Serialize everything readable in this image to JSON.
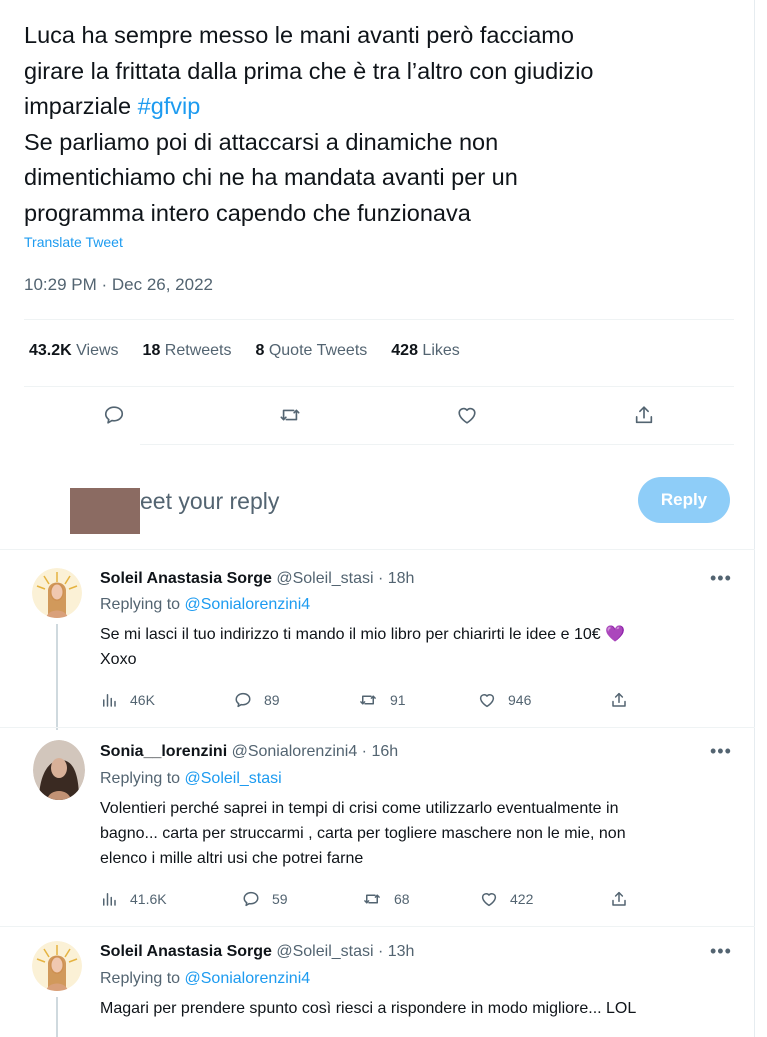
{
  "tweet": {
    "text_lines": [
      "Luca ha sempre messo le mani avanti però facciamo",
      "girare la frittata dalla prima che è tra l’altro con giudizio",
      "imparziale ",
      "Se parliamo poi di attaccarsi a dinamiche non",
      "dimentichiamo chi ne ha mandata avanti per un",
      "programma intero capendo che funzionava"
    ],
    "hashtag": "#gfvip",
    "translate_label": "Translate Tweet",
    "timestamp": "10:29 PM · Dec 26, 2022",
    "stats": {
      "views_count": "43.2K",
      "views_label": " Views",
      "retweets_count": "18",
      "retweets_label": " Retweets",
      "quotes_count": "8",
      "quotes_label": " Quote Tweets",
      "likes_count": "428",
      "likes_label": " Likes"
    },
    "action_icons": [
      "reply-icon",
      "retweet-icon",
      "like-icon",
      "share-icon"
    ]
  },
  "composer": {
    "placeholder": "eet your reply",
    "reply_button": "Reply"
  },
  "replies": [
    {
      "name": "Soleil Anastasia Sorge",
      "handle": " @Soleil_stasi · 18h",
      "replying_prefix": "Replying to ",
      "replying_to": "@Sonialorenzini4",
      "body_lines": [
        "Se mi lasci il tuo indirizzo ti mando il mio libro per chiarirti le idee e 10€ 💜",
        "Xoxo"
      ],
      "views": "46K",
      "replies": "89",
      "retweets": "91",
      "likes": "946"
    },
    {
      "name": "Sonia__lorenzini",
      "handle": " @Sonialorenzini4 · 16h",
      "replying_prefix": "Replying to ",
      "replying_to": "@Soleil_stasi",
      "body_lines": [
        "Volentieri perché saprei in tempi di crisi come utilizzarlo eventualmente in",
        "bagno... carta per struccarmi , carta per togliere maschere non le mie, non",
        "elenco i mille altri usi che potrei farne"
      ],
      "views": "41.6K",
      "replies": "59",
      "retweets": "68",
      "likes": "422"
    },
    {
      "name": "Soleil Anastasia Sorge",
      "handle": " @Soleil_stasi · 13h",
      "replying_prefix": "Replying to ",
      "replying_to": "@Sonialorenzini4",
      "body_lines": [
        "Magari per prendere spunto così riesci a rispondere in modo migliore... LOL"
      ]
    }
  ],
  "more_label": "•••",
  "colors": {
    "accent": "#1d9bf0",
    "text": "#0f1419",
    "muted": "#536471",
    "reply_button": "#8ecdf8"
  }
}
